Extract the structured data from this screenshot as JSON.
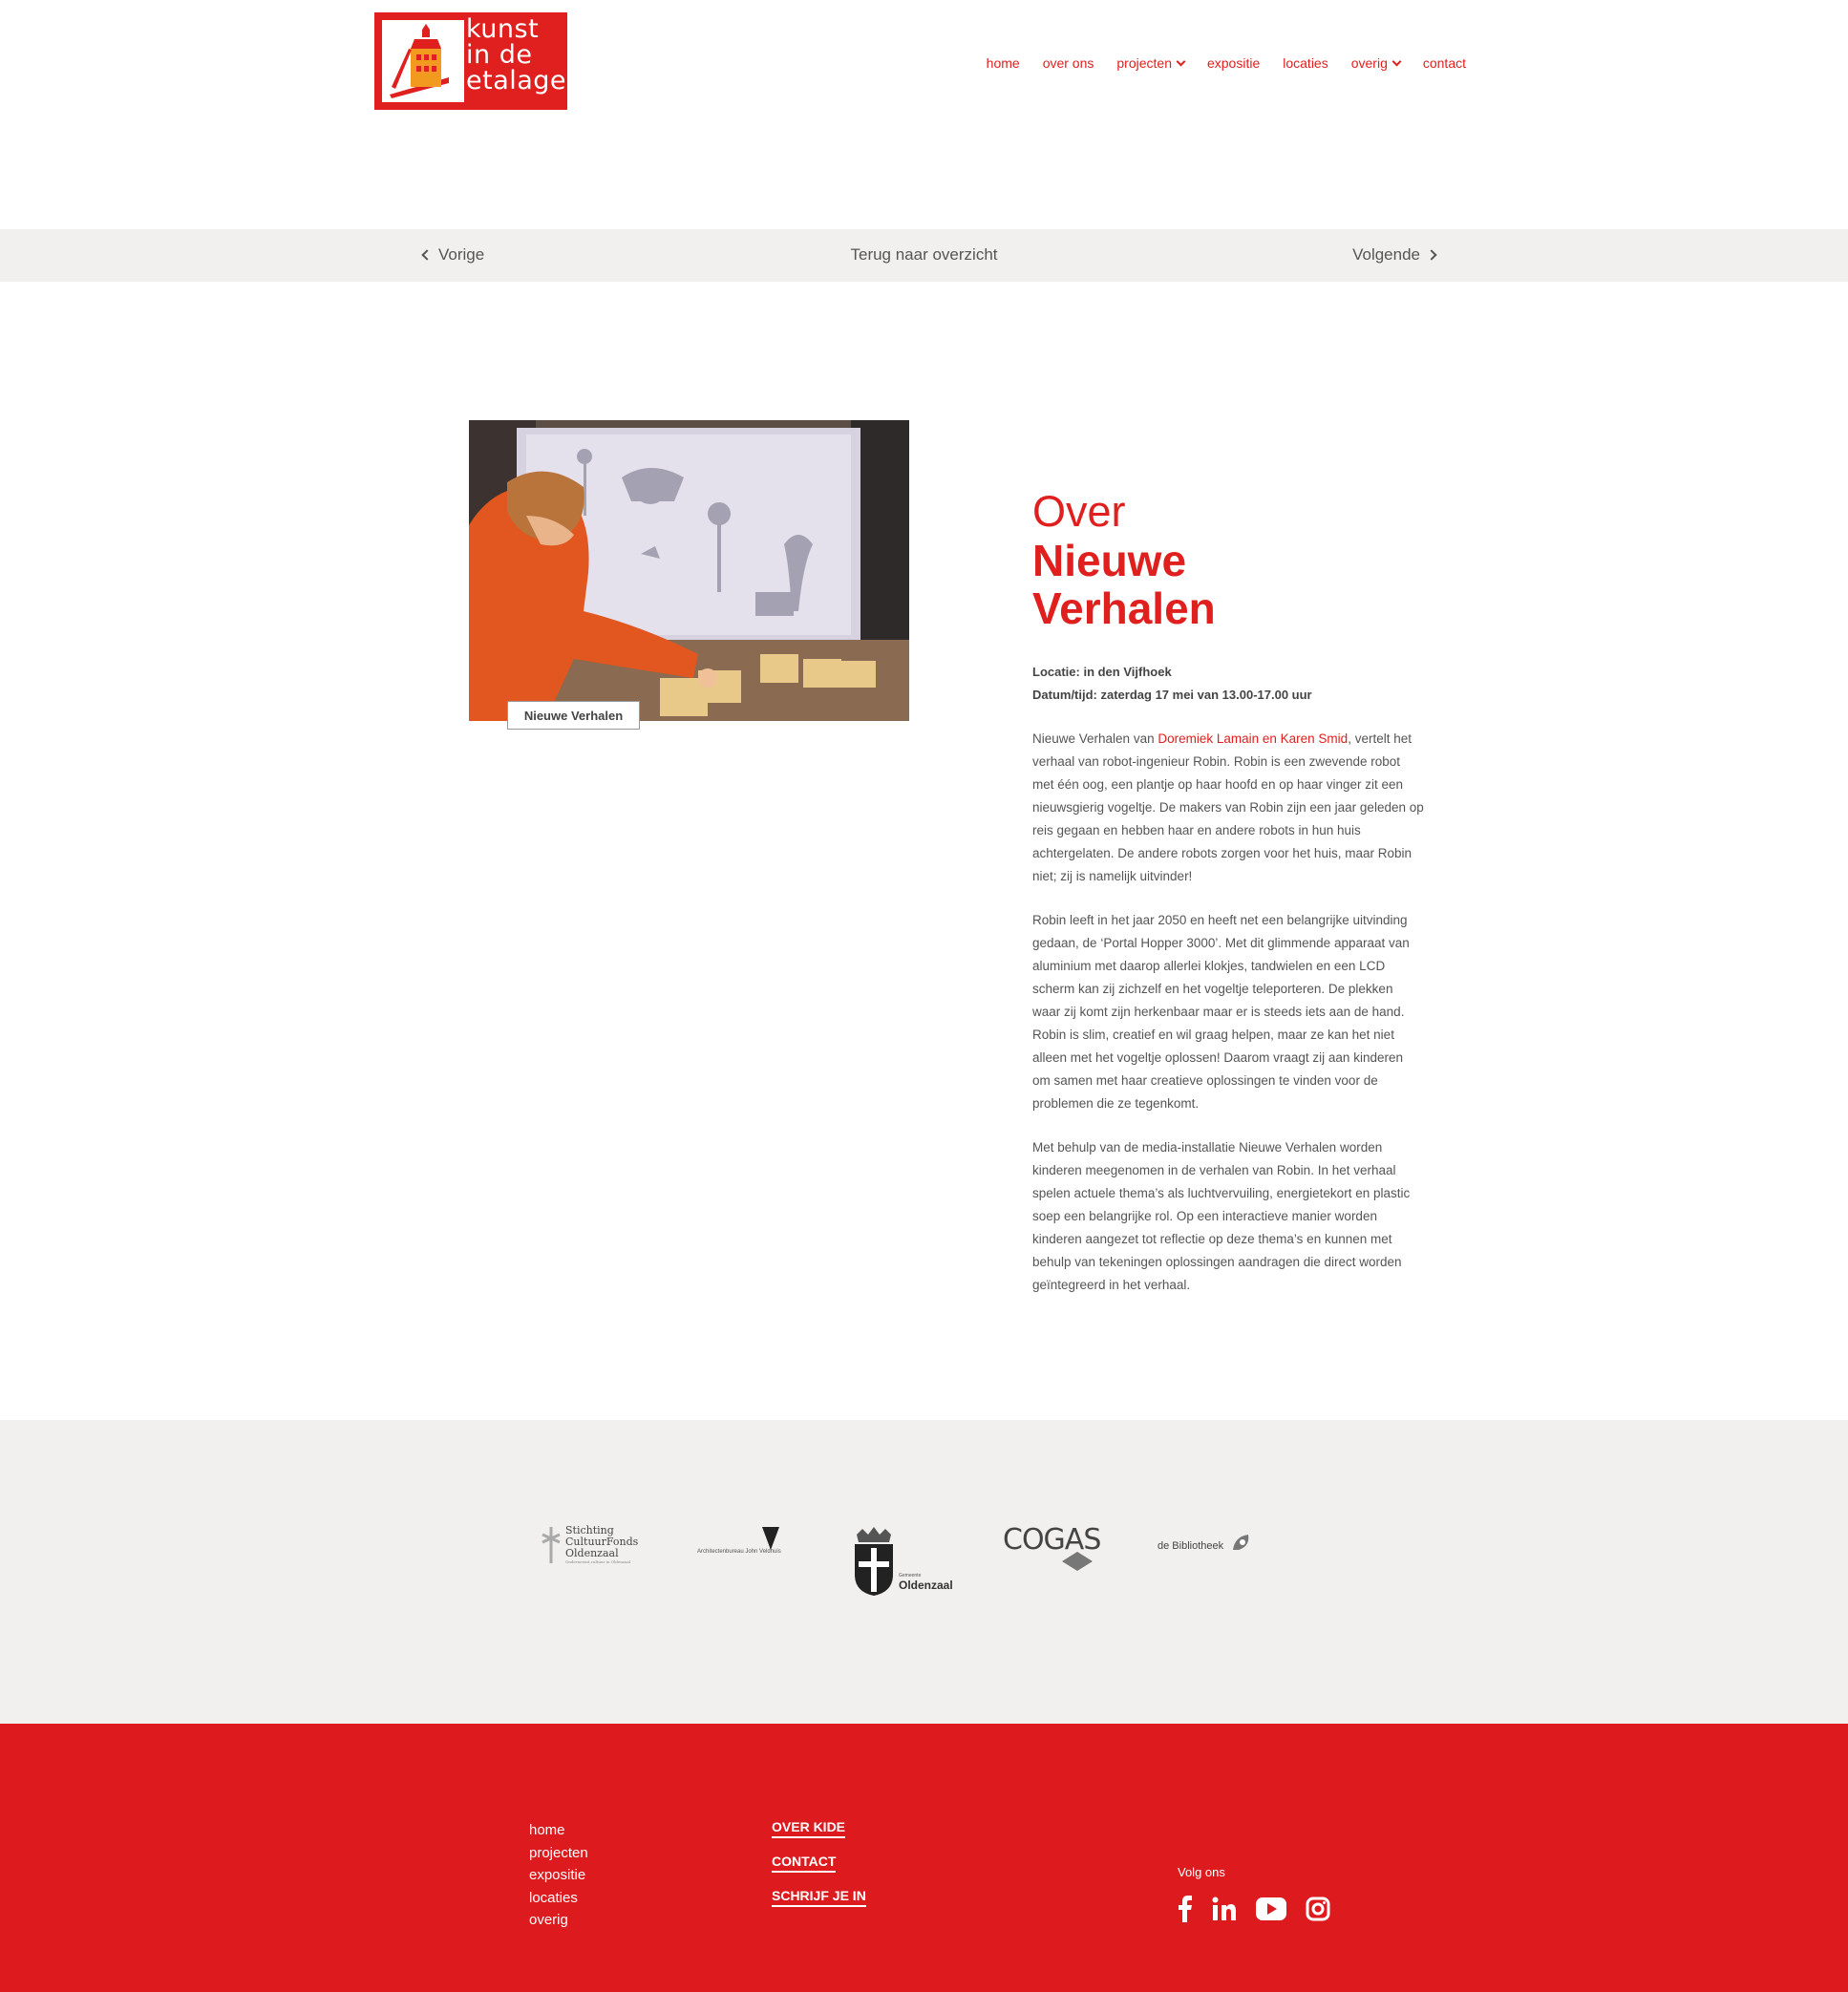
{
  "brand": {
    "logo_text_line1": "kunst",
    "logo_text_line2": "in de",
    "logo_text_line3": "etalage",
    "accent_color": "#e0201f"
  },
  "nav": {
    "items": [
      {
        "label": "home",
        "has_dropdown": false
      },
      {
        "label": "over ons",
        "has_dropdown": false
      },
      {
        "label": "projecten",
        "has_dropdown": true
      },
      {
        "label": "expositie",
        "has_dropdown": false
      },
      {
        "label": "locaties",
        "has_dropdown": false
      },
      {
        "label": "overig",
        "has_dropdown": true
      },
      {
        "label": "contact",
        "has_dropdown": false
      }
    ]
  },
  "pager": {
    "prev_label": "Vorige",
    "back_label": "Terug naar overzicht",
    "next_label": "Volgende"
  },
  "project": {
    "image_caption": "Nieuwe Verhalen",
    "title_prefix": "Over",
    "title_line1": "Nieuwe",
    "title_line2": "Verhalen",
    "location": "Locatie: in den Vijfhoek",
    "datetime": "Datum/tijd: zaterdag 17 mei van 13.00-17.00 uur",
    "para1_before": "Nieuwe Verhalen van ",
    "para1_link": "Doremiek Lamain en Karen Smid",
    "para1_after": ", vertelt het verhaal van robot-ingenieur Robin. Robin is een zwevende robot met één oog, een plantje op haar hoofd en op haar vinger zit een nieuwsgierig vogeltje. De makers van Robin zijn een jaar geleden op reis gegaan en hebben haar en andere robots in hun huis achtergelaten. De andere robots zorgen voor het huis, maar Robin niet; zij is namelijk uitvinder!",
    "para2": "Robin leeft in het jaar 2050 en heeft net een belangrijke uitvinding gedaan, de ‘Portal Hopper 3000’. Met dit glimmende apparaat van aluminium met daarop allerlei klokjes, tandwielen en een LCD scherm kan zij zichzelf en het vogeltje teleporteren. De plekken waar zij komt zijn herkenbaar maar er is steeds iets aan de hand. Robin is slim, creatief en wil graag helpen, maar ze kan het niet alleen met het vogeltje oplossen! Daarom vraagt zij aan kinderen om samen met haar creatieve oplossingen te vinden voor de problemen die ze tegenkomt.",
    "para3": "Met behulp van de media-installatie Nieuwe Verhalen worden kinderen meegenomen in de verhalen van Robin. In het verhaal spelen actuele thema’s als luchtvervuiling, energietekort en plastic soep een belangrijke rol. Op een interactieve manier worden kinderen aangezet tot reflectie op deze thema’s en kunnen met behulp van tekeningen oplossingen aandragen die direct worden geïntegreerd in het verhaal."
  },
  "sponsors": {
    "s1_line1": "Stichting",
    "s1_line2": "CultuurFonds",
    "s1_line3": "Oldenzaal",
    "s1_tagline": "Onderneemt cultuur in Oldenzaal",
    "s2_text": "Architectenbureau John Veldhuis",
    "s3_small": "Gemeente",
    "s3_text": "Oldenzaal",
    "s4_text": "COGAS",
    "s5_text": "de Bibliotheek"
  },
  "footer": {
    "links": [
      "home",
      "projecten",
      "expositie",
      "locaties",
      "overig"
    ],
    "cta": [
      "OVER KIDE",
      "CONTACT",
      "SCHRIJF JE IN"
    ],
    "social_label": "Volg ons",
    "social_icons": [
      "facebook-icon",
      "linkedin-icon",
      "youtube-icon",
      "instagram-icon"
    ],
    "bg_color": "#dd1b1e"
  }
}
